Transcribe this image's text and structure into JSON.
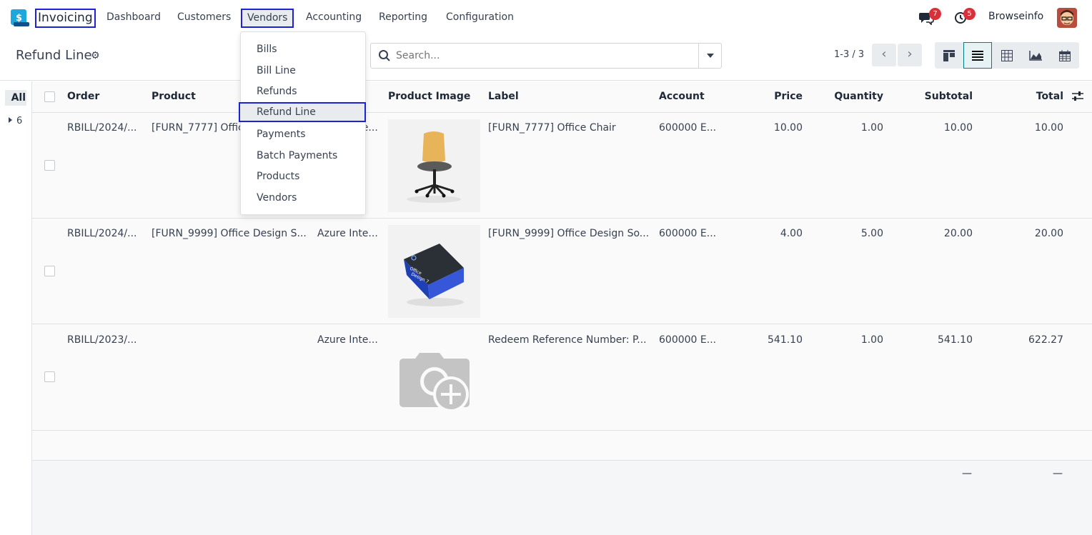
{
  "navbar": {
    "app_name": "Invoicing",
    "menus": [
      "Dashboard",
      "Customers",
      "Vendors",
      "Accounting",
      "Reporting",
      "Configuration"
    ],
    "active_menu": "Vendors",
    "messages_count": "7",
    "activities_count": "5",
    "user_name": "Browseinfo"
  },
  "control_panel": {
    "title": "Refund Line",
    "search_placeholder": "Search...",
    "pager": "1-3 / 3",
    "views": [
      "kanban-view-icon",
      "list-view-icon",
      "pivot-view-icon",
      "graph-view-icon",
      "calendar-view-icon"
    ],
    "active_view": "list-view-icon"
  },
  "left_panel": {
    "all_label": "All",
    "group_label": "6"
  },
  "table": {
    "columns": [
      "Order",
      "Product",
      "Product Image",
      "Label",
      "Account",
      "Price",
      "Quantity",
      "Subtotal",
      "Total"
    ],
    "rows": [
      {
        "order": "RBILL/2024/...",
        "product": "[FURN_7777] Office Chair",
        "partner": "Azure Inte...",
        "image": "office-chair",
        "label": "[FURN_7777] Office Chair",
        "account": "600000 E...",
        "price": "10.00",
        "quantity": "1.00",
        "subtotal": "10.00",
        "total": "10.00"
      },
      {
        "order": "RBILL/2024/...",
        "product": "[FURN_9999] Office Design S...",
        "partner": "Azure Inte...",
        "image": "office-design-software-box",
        "label": "[FURN_9999] Office Design So...",
        "account": "600000 E...",
        "price": "4.00",
        "quantity": "5.00",
        "subtotal": "20.00",
        "total": "20.00"
      },
      {
        "order": "RBILL/2023/...",
        "product": "",
        "partner": "Azure Inte...",
        "image": "placeholder-camera",
        "label": "Redeem Reference Number: P...",
        "account": "600000 E...",
        "price": "541.10",
        "quantity": "1.00",
        "subtotal": "541.10",
        "total": "622.27"
      }
    ],
    "totals": {
      "subtotal": "—",
      "total": "—"
    }
  },
  "dropdown": {
    "items": [
      "Bills",
      "Bill Line",
      "Refunds",
      "Refund Line",
      "Payments",
      "Batch Payments",
      "Products",
      "Vendors"
    ],
    "active": "Refund Line"
  },
  "colors": {
    "accent": "#017e84",
    "highlight_border": "#1c22d6",
    "badge": "#d9313a",
    "app_icon": "#1ea7dc"
  }
}
